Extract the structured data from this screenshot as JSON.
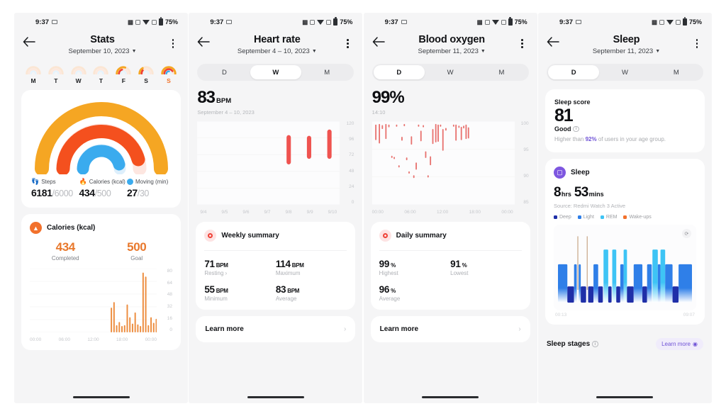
{
  "statusbar": {
    "time": "9:37",
    "battery": "75%",
    "icons": [
      "mail-icon",
      "signal-icon",
      "bluetooth-icon",
      "wifi-icon",
      "alarm-icon",
      "battery-icon"
    ]
  },
  "colors": {
    "orange": "#f5a623",
    "deep_orange": "#f2712c",
    "red": "#ef4136",
    "blue": "#3aabee",
    "heart_red": "#ef5350",
    "purple": "#6f52d6",
    "deep_sleep": "#1f2fa8",
    "light_sleep": "#2f7fe8",
    "rem": "#3ec4f5",
    "wake": "#f2712c"
  },
  "screens": [
    {
      "id": "stats",
      "title": "Stats",
      "date": "September 10, 2023",
      "week": [
        {
          "label": "M",
          "highlight": false,
          "steps": 0.08,
          "cal": 0.0,
          "move": 0.0
        },
        {
          "label": "T",
          "highlight": false,
          "steps": 0.1,
          "cal": 0.0,
          "move": 0.0
        },
        {
          "label": "W",
          "highlight": false,
          "steps": 0.07,
          "cal": 0.0,
          "move": 0.0
        },
        {
          "label": "T",
          "highlight": false,
          "steps": 0.06,
          "cal": 0.0,
          "move": 0.0
        },
        {
          "label": "F",
          "highlight": false,
          "steps": 0.55,
          "cal": 0.3,
          "move": 0.0
        },
        {
          "label": "S",
          "highlight": false,
          "steps": 0.22,
          "cal": 0.16,
          "move": 0.0
        },
        {
          "label": "S",
          "highlight": true,
          "steps": 1.0,
          "cal": 0.82,
          "move": 0.45
        }
      ],
      "rings": {
        "steps_pct": 100,
        "calories_pct": 87,
        "moving_pct": 90
      },
      "metrics": [
        {
          "icon": "footsteps-icon",
          "label": "Steps",
          "value": "6181",
          "goal": "/6000"
        },
        {
          "icon": "flame-icon",
          "label": "Calories (kcal)",
          "value": "434",
          "goal": "/500"
        },
        {
          "icon": "clock-icon",
          "label": "Moving (min)",
          "value": "27",
          "goal": "/30"
        }
      ],
      "calories_card": {
        "icon": "flame-icon",
        "title": "Calories (kcal)",
        "completed_value": "434",
        "completed_label": "Completed",
        "goal_value": "500",
        "goal_label": "Goal"
      },
      "chart_data": {
        "type": "bar",
        "title": "Calories (kcal)",
        "xlabel": "",
        "ylabel": "kcal",
        "ylim": [
          0,
          80
        ],
        "yticks": [
          "80",
          "64",
          "48",
          "32",
          "16",
          "0"
        ],
        "xticks": [
          "00:00",
          "06:00",
          "12:00",
          "18:00",
          "00:00"
        ],
        "grid": true,
        "bar_color": "#ed8e41",
        "x": [
          15.3,
          15.8,
          16.3,
          16.8,
          17.3,
          17.8,
          18.3,
          18.8,
          19.3,
          19.8,
          20.3,
          20.8,
          21.3,
          21.8,
          22.3,
          22.8,
          23.3,
          23.8
        ],
        "values": [
          31,
          38,
          9,
          13,
          8,
          9,
          35,
          19,
          11,
          25,
          10,
          8,
          75,
          70,
          9,
          19,
          12,
          17
        ]
      }
    },
    {
      "id": "heart-rate",
      "title": "Heart rate",
      "date": "September 4 – 10, 2023",
      "tabs": [
        {
          "label": "D",
          "active": false
        },
        {
          "label": "W",
          "active": true
        },
        {
          "label": "M",
          "active": false
        }
      ],
      "headline_value": "83",
      "headline_unit": "BPM",
      "headline_sub": "September 4 – 10, 2023",
      "chart_data": {
        "type": "range-bar",
        "title": "Heart rate weekly",
        "ylim": [
          0,
          120
        ],
        "yticks": [
          "120",
          "96",
          "72",
          "48",
          "24",
          "0"
        ],
        "xticks": [
          "9/4",
          "9/5",
          "9/6",
          "9/7",
          "9/8",
          "9/9",
          "9/10"
        ],
        "bar_color": "#ef5350",
        "series": [
          {
            "x": "9/4",
            "low": null,
            "high": null
          },
          {
            "x": "9/5",
            "low": null,
            "high": null
          },
          {
            "x": "9/6",
            "low": null,
            "high": null
          },
          {
            "x": "9/7",
            "low": null,
            "high": null
          },
          {
            "x": "9/8",
            "low": 58,
            "high": 100
          },
          {
            "x": "9/9",
            "low": 66,
            "high": 99
          },
          {
            "x": "9/10",
            "low": 66,
            "high": 108
          }
        ]
      },
      "summary": {
        "icon": "heart-rate-icon",
        "title": "Weekly summary",
        "items": [
          {
            "value": "71",
            "unit": "BPM",
            "label": "Resting",
            "chevron": "›"
          },
          {
            "value": "114",
            "unit": "BPM",
            "label": "Maximum",
            "chevron": ""
          },
          {
            "value": "55",
            "unit": "BPM",
            "label": "Minimum",
            "chevron": ""
          },
          {
            "value": "83",
            "unit": "BPM",
            "label": "Average",
            "chevron": ""
          }
        ]
      },
      "learn_more": "Learn more"
    },
    {
      "id": "blood-oxygen",
      "title": "Blood oxygen",
      "date": "September 11, 2023",
      "tabs": [
        {
          "label": "D",
          "active": true
        },
        {
          "label": "W",
          "active": false
        },
        {
          "label": "M",
          "active": false
        }
      ],
      "headline_value": "99%",
      "headline_sub": "14:10",
      "chart_data": {
        "type": "range-bar",
        "title": "Blood oxygen daily",
        "ylim": [
          85,
          100
        ],
        "yticks": [
          "100",
          "95",
          "90",
          "85"
        ],
        "xticks": [
          "00:00",
          "06:00",
          "12:00",
          "18:00",
          "00:00"
        ],
        "bar_color": "#e8726f",
        "points": [
          {
            "t": 0.5,
            "low": 96.6,
            "high": 99.4
          },
          {
            "t": 1.1,
            "low": 96.0,
            "high": 99.5
          },
          {
            "t": 1.6,
            "low": 98.6,
            "high": 99.3
          },
          {
            "t": 2.2,
            "low": 96.8,
            "high": 99.5
          },
          {
            "t": 2.7,
            "low": 98.9,
            "high": 99.4
          },
          {
            "t": 3.2,
            "low": 93.4,
            "high": 93.8
          },
          {
            "t": 3.6,
            "low": 93.2,
            "high": 93.6
          },
          {
            "t": 4.0,
            "low": 99.0,
            "high": 99.4
          },
          {
            "t": 4.4,
            "low": 91.7,
            "high": 92.1
          },
          {
            "t": 4.9,
            "low": 96.5,
            "high": 97.2
          },
          {
            "t": 5.3,
            "low": 99.1,
            "high": 99.5
          },
          {
            "t": 5.7,
            "low": 93.0,
            "high": 93.5
          },
          {
            "t": 6.1,
            "low": 90.6,
            "high": 91.0
          },
          {
            "t": 6.5,
            "low": 95.8,
            "high": 97.3
          },
          {
            "t": 6.9,
            "low": 89.8,
            "high": 90.3
          },
          {
            "t": 7.3,
            "low": 91.3,
            "high": 92.6
          },
          {
            "t": 7.7,
            "low": 99.0,
            "high": 99.4
          },
          {
            "t": 8.1,
            "low": 96.4,
            "high": 98.3
          },
          {
            "t": 8.5,
            "low": 98.9,
            "high": 99.3
          },
          {
            "t": 8.9,
            "low": 93.4,
            "high": 94.6
          },
          {
            "t": 9.3,
            "low": 89.9,
            "high": 90.3
          },
          {
            "t": 9.7,
            "low": 92.1,
            "high": 93.7
          },
          {
            "t": 10.1,
            "low": 95.9,
            "high": 98.6
          },
          {
            "t": 10.6,
            "low": 96.2,
            "high": 99.5
          },
          {
            "t": 11.0,
            "low": 96.3,
            "high": 99.4
          },
          {
            "t": 11.4,
            "low": 99.0,
            "high": 99.4
          },
          {
            "t": 11.8,
            "low": 94.7,
            "high": 98.6
          },
          {
            "t": 12.3,
            "low": 98.3,
            "high": 98.8
          },
          {
            "t": 13.6,
            "low": 99.0,
            "high": 99.4
          },
          {
            "t": 14.0,
            "low": 96.5,
            "high": 99.4
          },
          {
            "t": 14.5,
            "low": 98.8,
            "high": 99.2
          },
          {
            "t": 14.9,
            "low": 96.6,
            "high": 99.0
          },
          {
            "t": 15.3,
            "low": 98.7,
            "high": 99.2
          },
          {
            "t": 15.7,
            "low": 96.8,
            "high": 99.4
          },
          {
            "t": 16.1,
            "low": 96.9,
            "high": 98.9
          }
        ]
      },
      "summary": {
        "icon": "blood-oxygen-icon",
        "title": "Daily summary",
        "items": [
          {
            "value": "99",
            "unit": "%",
            "label": "Highest",
            "chevron": ""
          },
          {
            "value": "91",
            "unit": "%",
            "label": "Lowest",
            "chevron": ""
          },
          {
            "value": "96",
            "unit": "%",
            "label": "Average",
            "chevron": ""
          }
        ]
      },
      "learn_more": "Learn more"
    },
    {
      "id": "sleep",
      "title": "Sleep",
      "date": "September 11, 2023",
      "tabs": [
        {
          "label": "D",
          "active": true
        },
        {
          "label": "W",
          "active": false
        },
        {
          "label": "M",
          "active": false
        }
      ],
      "score": {
        "label": "Sleep score",
        "value": "81",
        "quality": "Good",
        "comparison_prefix": "Higher than ",
        "comparison_value": "92%",
        "comparison_suffix": " of users in your age group."
      },
      "detail": {
        "icon": "bed-icon",
        "title": "Sleep",
        "hours": "8",
        "hours_unit": "hrs",
        "mins": "53",
        "mins_unit": "mins",
        "source": "Source: Redmi Watch 3 Active",
        "legend": [
          {
            "name": "Deep",
            "color": "#1f2fa8"
          },
          {
            "name": "Light",
            "color": "#2f7fe8"
          },
          {
            "name": "REM",
            "color": "#3ec4f5"
          },
          {
            "name": "Wake-ups",
            "color": "#f2712c"
          }
        ],
        "start_time": "00:13",
        "end_time": "09:07",
        "refresh_icon": "refresh-icon"
      },
      "chart_data": {
        "type": "area",
        "title": "Sleep stages",
        "xlabel": "time",
        "xticks": [
          "00:13",
          "09:07"
        ],
        "stage_levels": {
          "wake": 4,
          "rem": 3,
          "light": 2,
          "deep": 1
        },
        "segments": [
          {
            "stage": "light",
            "start": 0.0,
            "end": 0.07
          },
          {
            "stage": "deep",
            "start": 0.07,
            "end": 0.12
          },
          {
            "stage": "light",
            "start": 0.12,
            "end": 0.14
          },
          {
            "stage": "wake",
            "start": 0.145,
            "end": 0.155
          },
          {
            "stage": "light",
            "start": 0.155,
            "end": 0.17
          },
          {
            "stage": "deep",
            "start": 0.17,
            "end": 0.21
          },
          {
            "stage": "wake",
            "start": 0.215,
            "end": 0.225
          },
          {
            "stage": "deep",
            "start": 0.225,
            "end": 0.265
          },
          {
            "stage": "light",
            "start": 0.265,
            "end": 0.3
          },
          {
            "stage": "deep",
            "start": 0.3,
            "end": 0.335
          },
          {
            "stage": "rem",
            "start": 0.34,
            "end": 0.375
          },
          {
            "stage": "deep",
            "start": 0.375,
            "end": 0.4
          },
          {
            "stage": "rem",
            "start": 0.405,
            "end": 0.435
          },
          {
            "stage": "deep",
            "start": 0.435,
            "end": 0.465
          },
          {
            "stage": "light",
            "start": 0.465,
            "end": 0.49
          },
          {
            "stage": "rem",
            "start": 0.49,
            "end": 0.515
          },
          {
            "stage": "deep",
            "start": 0.515,
            "end": 0.565
          },
          {
            "stage": "light",
            "start": 0.565,
            "end": 0.63
          },
          {
            "stage": "deep",
            "start": 0.63,
            "end": 0.665
          },
          {
            "stage": "light",
            "start": 0.665,
            "end": 0.7
          },
          {
            "stage": "rem",
            "start": 0.705,
            "end": 0.745
          },
          {
            "stage": "light",
            "start": 0.745,
            "end": 0.765
          },
          {
            "stage": "rem",
            "start": 0.765,
            "end": 0.8
          },
          {
            "stage": "light",
            "start": 0.8,
            "end": 0.855
          },
          {
            "stage": "deep",
            "start": 0.855,
            "end": 0.9
          },
          {
            "stage": "light",
            "start": 0.9,
            "end": 1.0
          }
        ]
      },
      "stages": {
        "label": "Sleep stages",
        "learn_more": "Learn more"
      }
    }
  ]
}
